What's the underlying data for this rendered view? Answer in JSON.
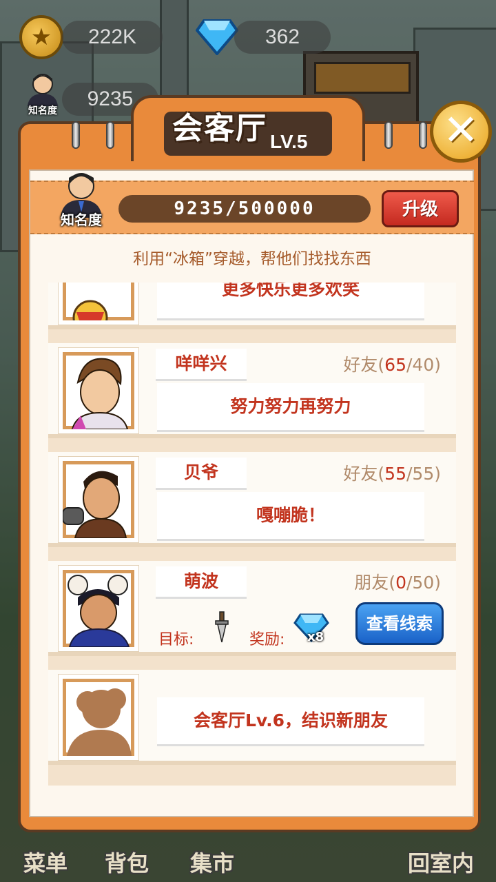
{
  "currency": {
    "coins": "222K",
    "gems": "362"
  },
  "fame_hud": {
    "label": "知名度",
    "value": "9235"
  },
  "panel": {
    "title": "会客厅",
    "level": "LV.5",
    "fame_label": "知名度",
    "fame_progress_text": "9235/500000",
    "fame_progress": 0.0185,
    "upgrade_label": "升级",
    "hint": "利用“冰箱”穿越，帮他们找找东西"
  },
  "partial_card": {
    "message": "更多快乐更多欢笑"
  },
  "characters": [
    {
      "name": "咩咩兴",
      "relation": "好友",
      "current": "65",
      "max": "40",
      "message": "努力努力再努力"
    },
    {
      "name": "贝爷",
      "relation": "好友",
      "current": "55",
      "max": "55",
      "message": "嘎嘣脆！"
    },
    {
      "name": "萌波",
      "relation": "朋友",
      "current": "0",
      "max": "50",
      "target_label": "目标:",
      "reward_label": "奖励:",
      "reward_count": "x8",
      "button_label": "查看线索"
    }
  ],
  "locked_card": {
    "message": "会客厅Lv.6，结识新朋友"
  },
  "bottom_nav": [
    "菜单",
    "背包",
    "集市",
    "回室内"
  ],
  "colors": {
    "panel_orange": "#e98a3b",
    "accent_red": "#c2341e",
    "button_blue": "#1a62c8"
  }
}
